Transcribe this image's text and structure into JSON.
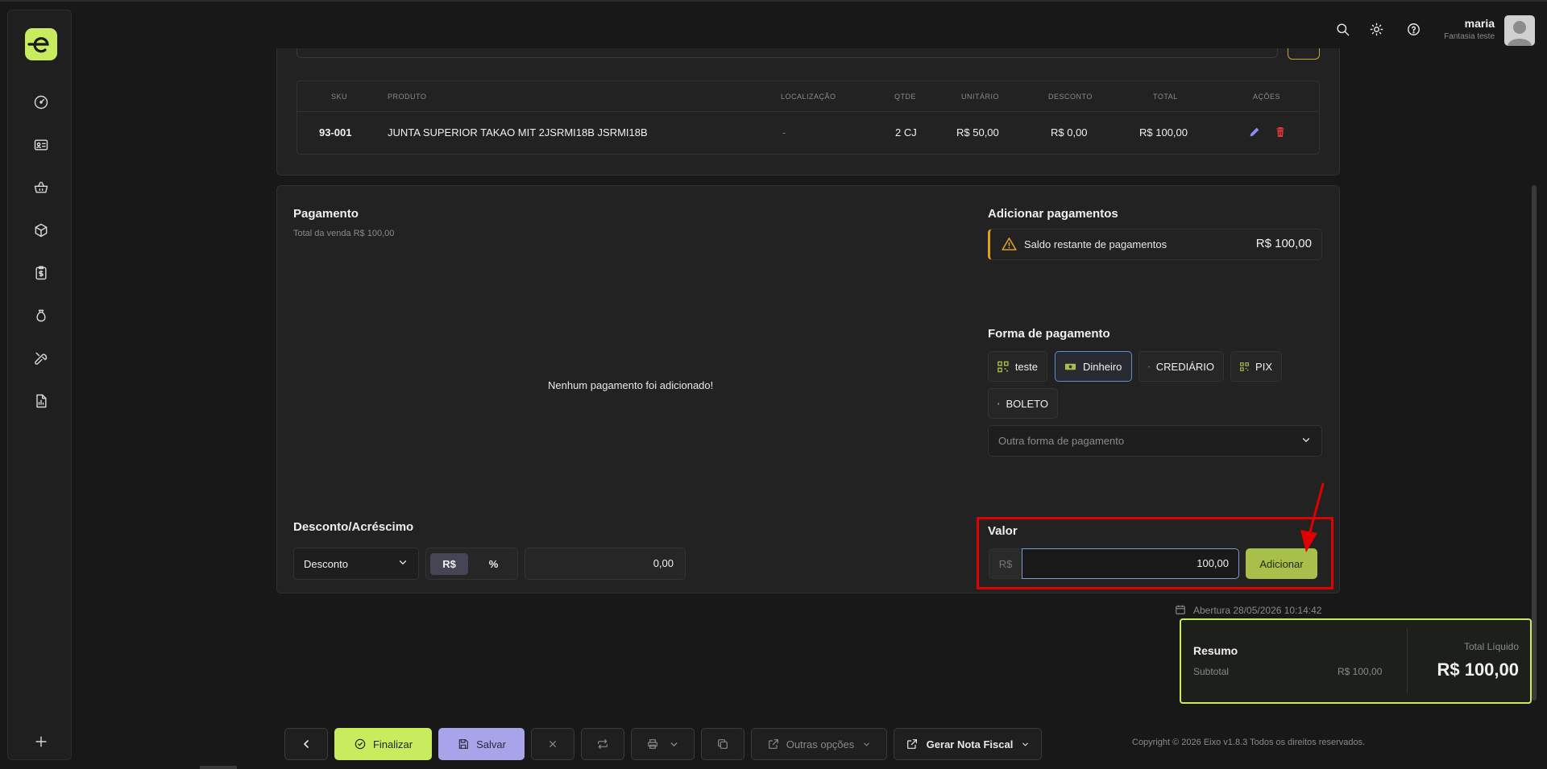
{
  "header": {
    "user_name": "maria",
    "user_company": "Fantasia teste",
    "icons": [
      "search-icon",
      "sun-icon",
      "help-icon"
    ]
  },
  "sidebar": {
    "items": [
      "dashboard-icon",
      "id-card-icon",
      "basket-icon",
      "box-icon",
      "clipboard-dollar-icon",
      "money-bag-icon",
      "wrench-icon",
      "report-icon"
    ],
    "add_icon": "plus-icon"
  },
  "products_table": {
    "headers": [
      "SKU",
      "PRODUTO",
      "LOCALIZAÇÃO",
      "QTDE",
      "UNITÁRIO",
      "DESCONTO",
      "TOTAL",
      "AÇÕES"
    ],
    "rows": [
      {
        "sku": "93-001",
        "produto": "JUNTA SUPERIOR TAKAO MIT 2JSRMI18B JSRMI18B",
        "localizacao": "-",
        "qtde": "2 CJ",
        "unitario": "R$ 50,00",
        "desconto": "R$ 0,00",
        "total": "R$ 100,00"
      }
    ]
  },
  "payment": {
    "title": "Pagamento",
    "subtitle": "Total da venda R$ 100,00",
    "empty_message": "Nenhum pagamento foi adicionado!",
    "add_title": "Adicionar pagamentos",
    "saldo_label": "Saldo restante de pagamentos",
    "saldo_value": "R$ 100,00",
    "methods_title": "Forma de pagamento",
    "methods": [
      {
        "label": "teste",
        "icon": "qr-icon"
      },
      {
        "label": "Dinheiro",
        "icon": "cash-icon",
        "active": true
      },
      {
        "label": "CREDIÁRIO",
        "icon": "document-dollar-icon"
      },
      {
        "label": "PIX",
        "icon": "qr-icon"
      },
      {
        "label": "BOLETO",
        "icon": "document-dollar-icon"
      }
    ],
    "other_method_placeholder": "Outra forma de pagamento",
    "valor_title": "Valor",
    "currency": "R$",
    "valor_value": "100,00",
    "add_button": "Adicionar"
  },
  "discount": {
    "title": "Desconto/Acréscimo",
    "type_selected": "Desconto",
    "unit_options": [
      "R$",
      "%"
    ],
    "value": "0,00"
  },
  "summary": {
    "abertura": "Abertura 28/05/2026 10:14:42",
    "title": "Resumo",
    "subtotal_label": "Subtotal",
    "subtotal_value": "R$ 100,00",
    "total_label": "Total Líquido",
    "total_value": "R$ 100,00"
  },
  "footer": {
    "finalizar": "Finalizar",
    "salvar": "Salvar",
    "outras_opcoes": "Outras opções",
    "gerar_nota": "Gerar Nota Fiscal",
    "copyright": "Copyright © 2026 Eixo v1.8.3 Todos os direitos reservados."
  },
  "colors": {
    "accent_green": "#c8ec5d",
    "button_green": "#a8c04a",
    "salvar_purple": "#a9a4ea",
    "annotation_red": "#e00000",
    "warning_orange": "#e0a020",
    "delete_red": "#e53935",
    "edit_purple": "#8f8cf5"
  }
}
